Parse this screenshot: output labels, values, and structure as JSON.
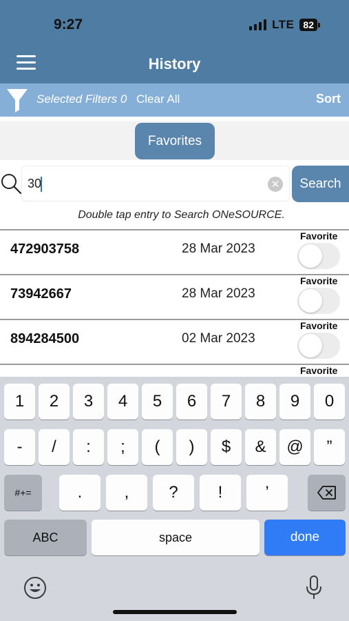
{
  "status": {
    "time": "9:27",
    "network": "LTE",
    "battery": "82"
  },
  "nav": {
    "title": "History"
  },
  "filters": {
    "selected": "Selected Filters 0",
    "clear_all": "Clear All",
    "sort": "Sort"
  },
  "favorites_button": "Favorites",
  "search": {
    "value": "30",
    "button": "Search",
    "hint": "Double tap entry to Search ONeSOURCE."
  },
  "results": [
    {
      "id": "472903758",
      "date": "28 Mar 2023",
      "favorite_label": "Favorite"
    },
    {
      "id": "73942667",
      "date": "28 Mar 2023",
      "favorite_label": "Favorite"
    },
    {
      "id": "894284500",
      "date": "02 Mar 2023",
      "favorite_label": "Favorite"
    },
    {
      "id": "",
      "date": "",
      "favorite_label": "Favorite"
    }
  ],
  "keyboard": {
    "row1": [
      "1",
      "2",
      "3",
      "4",
      "5",
      "6",
      "7",
      "8",
      "9",
      "0"
    ],
    "row2": [
      "-",
      "/",
      ":",
      ";",
      "(",
      ")",
      "$",
      "&",
      "@",
      "”"
    ],
    "row3": [
      ".",
      ",",
      "?",
      "!",
      "’"
    ],
    "symbols_key": "#+=",
    "abc_key": "ABC",
    "space_key": "space",
    "done_key": "done"
  },
  "colors": {
    "nav": "#4f7ca2",
    "filter_bar": "#86afd8",
    "button": "#5a86ad",
    "done_key": "#2f7cf6"
  }
}
